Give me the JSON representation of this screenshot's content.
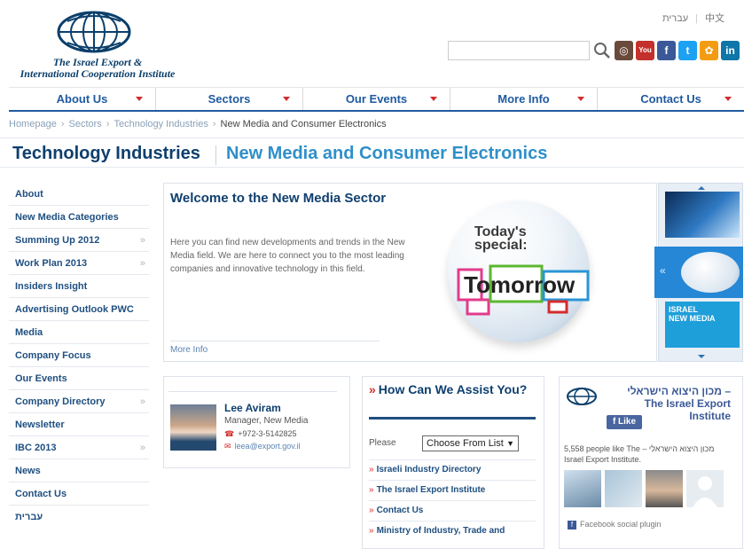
{
  "languages": [
    "עברית",
    "中文"
  ],
  "logo": {
    "name_line1": "The Israel Export &",
    "name_line2": "International Cooperation Institute"
  },
  "search": {
    "placeholder": ""
  },
  "social": [
    {
      "name": "instagram-icon",
      "color": "#6a4a3a",
      "glyph": "◎"
    },
    {
      "name": "youtube-icon",
      "color": "#c4302b",
      "glyph": "You"
    },
    {
      "name": "facebook-icon",
      "color": "#3b5998",
      "glyph": "f"
    },
    {
      "name": "twitter-icon",
      "color": "#1da1f2",
      "glyph": "t"
    },
    {
      "name": "community-icon",
      "color": "#f39c12",
      "glyph": "✿"
    },
    {
      "name": "linkedin-icon",
      "color": "#0e76a8",
      "glyph": "in"
    }
  ],
  "nav": [
    "About Us",
    "Sectors",
    "Our Events",
    "More Info",
    "Contact Us"
  ],
  "breadcrumb": [
    "Homepage",
    "Sectors",
    "Technology Industries",
    "New Media and Consumer Electronics"
  ],
  "title": {
    "main": "Technology Industries",
    "sub": "New Media and Consumer Electronics"
  },
  "sidebar": [
    {
      "label": "About",
      "arrow": ""
    },
    {
      "label": "New Media Categories",
      "arrow": ""
    },
    {
      "label": "Summing Up 2012",
      "arrow": "»"
    },
    {
      "label": "Work Plan 2013",
      "arrow": "»"
    },
    {
      "label": "Insiders Insight",
      "arrow": ""
    },
    {
      "label": "Advertising Outlook PWC",
      "arrow": ""
    },
    {
      "label": "Media",
      "arrow": ""
    },
    {
      "label": "Company Focus",
      "arrow": ""
    },
    {
      "label": "Our Events",
      "arrow": ""
    },
    {
      "label": "Company Directory",
      "arrow": "»"
    },
    {
      "label": "Newsletter",
      "arrow": ""
    },
    {
      "label": "IBC 2013",
      "arrow": "»"
    },
    {
      "label": "News",
      "arrow": ""
    },
    {
      "label": "Contact Us",
      "arrow": ""
    },
    {
      "label": "עברית",
      "arrow": ""
    }
  ],
  "welcome": {
    "title": "Welcome to the New Media Sector",
    "text": "Here you can find new developments and trends in the New Media field. We are here to connect you to the most leading companies and innovative technology in this field.",
    "more": "More Info"
  },
  "sphere": {
    "line1": "Today's",
    "line2": "special:",
    "word": "Tomorrow"
  },
  "carousel": {
    "thumb3_line1": "ISRAEL",
    "thumb3_line2": "NEW MEDIA"
  },
  "contact": {
    "name": "Lee Aviram",
    "role": "Manager, New Media",
    "phone": "+972-3-5142825",
    "email": "leea@export.gov.il"
  },
  "assist": {
    "title": "How Can We Assist You?",
    "please": "Please",
    "choose": "Choose From List",
    "links": [
      "Israeli Industry Directory",
      "The Israel Export Institute",
      "Contact Us",
      "Ministry of Industry, Trade and"
    ]
  },
  "facebook": {
    "name": "מכון היצוא הישראלי – The Israel Export Institute",
    "like": "Like",
    "count": "5,558 people like The – מכון היצוא הישראלי Israel Export Institute.",
    "plugin": "Facebook social plugin"
  }
}
